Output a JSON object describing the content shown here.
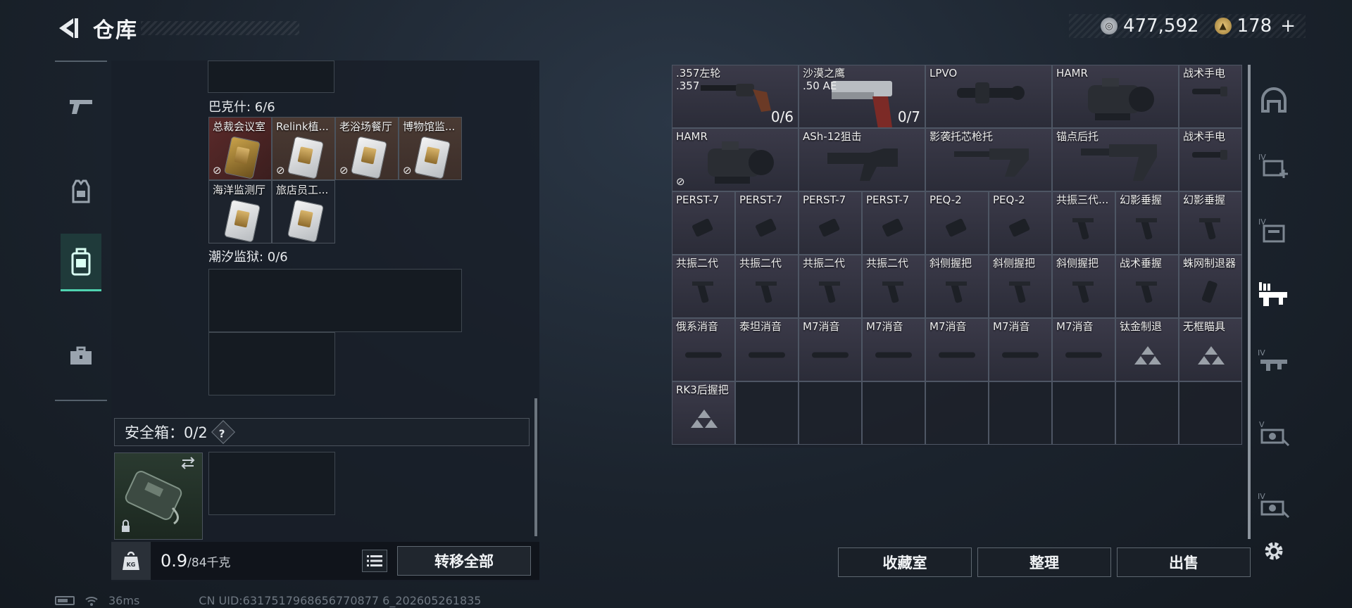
{
  "header": {
    "title": "仓库",
    "currency1": "477,592",
    "currency2": "178",
    "currency2_add": "+"
  },
  "left_nav": [
    "weapon-icon",
    "armor-icon",
    "backpack-icon",
    "toolbox-icon"
  ],
  "left_panel": {
    "group1": {
      "label": "巴克什: 6/6",
      "items": [
        {
          "name": "总裁会议室",
          "style": "red",
          "card": "gold"
        },
        {
          "name": "Relink植...",
          "style": "brown",
          "card": "silver"
        },
        {
          "name": "老浴场餐厅",
          "style": "brown",
          "card": "silver"
        },
        {
          "name": "博物馆监...",
          "style": "brown",
          "card": "silver"
        },
        {
          "name": "海洋监测厅",
          "style": "normal",
          "card": "silver"
        },
        {
          "name": "旅店员工...",
          "style": "normal",
          "card": "silver"
        }
      ]
    },
    "group2": {
      "label": "潮汐监狱: 0/6"
    },
    "safebox": {
      "label": "安全箱：0/2",
      "help": "?"
    },
    "footer": {
      "weight": "0.9",
      "weight_cap": "/84千克",
      "weight_icon": "KG",
      "transfer_label": "转移全部"
    }
  },
  "right_grid": {
    "row1": [
      {
        "name": ".357左轮",
        "sub": ".357",
        "count": "0/6",
        "img": "revolver"
      },
      {
        "name": "沙漠之鹰",
        "sub": ".50 AE",
        "count": "0/7",
        "img": "deagle"
      },
      {
        "name": "LPVO",
        "img": "scope"
      },
      {
        "name": "HAMR",
        "img": "hamr"
      },
      {
        "name": "战术手电",
        "img": "flashlight"
      }
    ],
    "row2": [
      {
        "name": "HAMR",
        "img": "hamr",
        "nosell": true
      },
      {
        "name": "ASh-12狙击",
        "img": "stock"
      },
      {
        "name": "影袭托芯枪托",
        "img": "stock2"
      },
      {
        "name": "锚点后托",
        "img": "stock3"
      },
      {
        "name": "战术手电",
        "img": "flashlight"
      }
    ],
    "row3": [
      "PERST-7",
      "PERST-7",
      "PERST-7",
      "PERST-7",
      "PEQ-2",
      "PEQ-2",
      "共振三代...",
      "幻影垂握",
      "幻影垂握"
    ],
    "row4": [
      "共振二代",
      "共振二代",
      "共振二代",
      "共振二代",
      "斜侧握把",
      "斜侧握把",
      "斜侧握把",
      "战术垂握",
      "蛛网制退器"
    ],
    "row5": [
      "俄系消音",
      "泰坦消音",
      "M7消音",
      "M7消音",
      "M7消音",
      "M7消音",
      "M7消音",
      "钛金制退",
      "无框瞄具"
    ],
    "row6": [
      "RK3后握把"
    ]
  },
  "actions": {
    "collection": "收藏室",
    "sort": "整理",
    "sell": "出售"
  },
  "right_nav": [
    "helmet-icon",
    "IV",
    "IV",
    "weapon-mod-icon",
    "IV",
    "V",
    "IV",
    "settings-icon"
  ],
  "status": {
    "ping": "36ms",
    "uid": "CN UID:6317517968656770877 6_202605261835"
  },
  "colors": {
    "accent": "#4fd3b0",
    "cell": "#3b3a49"
  }
}
